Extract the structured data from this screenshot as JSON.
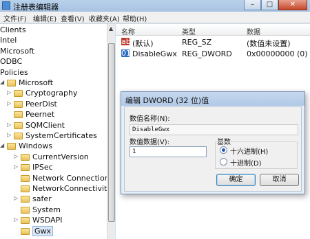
{
  "window": {
    "title": "注册表编辑器"
  },
  "menu": [
    "文件(F)",
    "编辑(E)",
    "查看(V)",
    "收藏夹(A)",
    "帮助(H)"
  ],
  "tree": {
    "items": [
      {
        "label": "Clients",
        "arrow": ""
      },
      {
        "label": "Intel",
        "arrow": ""
      },
      {
        "label": "Microsoft",
        "arrow": ""
      },
      {
        "label": "ODBC",
        "arrow": ""
      },
      {
        "label": "Policies",
        "arrow": ""
      },
      {
        "label": "Microsoft",
        "arrow": "◢"
      },
      {
        "label": "Cryptography",
        "arrow": "▷"
      },
      {
        "label": "PeerDist",
        "arrow": "▷"
      },
      {
        "label": "Peernet",
        "arrow": ""
      },
      {
        "label": "SQMClient",
        "arrow": "▷"
      },
      {
        "label": "SystemCertificates",
        "arrow": "▷"
      },
      {
        "label": "Windows",
        "arrow": "◢"
      },
      {
        "label": "CurrentVersion",
        "arrow": "▷"
      },
      {
        "label": "IPSec",
        "arrow": "▷"
      },
      {
        "label": "Network Connections",
        "arrow": ""
      },
      {
        "label": "NetworkConnectivityStat",
        "arrow": ""
      },
      {
        "label": "safer",
        "arrow": "▷"
      },
      {
        "label": "System",
        "arrow": ""
      },
      {
        "label": "WSDAPI",
        "arrow": "▷"
      },
      {
        "label": "Gwx",
        "arrow": ""
      }
    ]
  },
  "values": {
    "headers": [
      "名称",
      "类型",
      "数据"
    ],
    "rows": [
      {
        "icon": "ab",
        "name": "(默认)",
        "type": "REG_SZ",
        "data": "(数值未设置)"
      },
      {
        "icon": "bin",
        "name": "DisableGwx",
        "type": "REG_DWORD",
        "data": "0x00000000 (0)"
      }
    ]
  },
  "dialog": {
    "title": "编辑 DWORD (32 位)值",
    "name_label": "数值名称(N):",
    "name_value": "DisableGwx",
    "data_label": "数值数据(V):",
    "data_value": "1",
    "base_label": "基数",
    "hex_label": "十六进制(H)",
    "dec_label": "十进制(D)",
    "ok": "确定",
    "cancel": "取消"
  },
  "colors": {
    "titlebar": "#b9d1ea",
    "dialog_bg": "#e6eef7",
    "folder": "#e8c25a",
    "accent": "#1c5bb5"
  },
  "icons": {
    "close": "close-icon",
    "minimize": "minimize-icon",
    "maximize": "maximize-icon",
    "folder": "folder-icon"
  }
}
